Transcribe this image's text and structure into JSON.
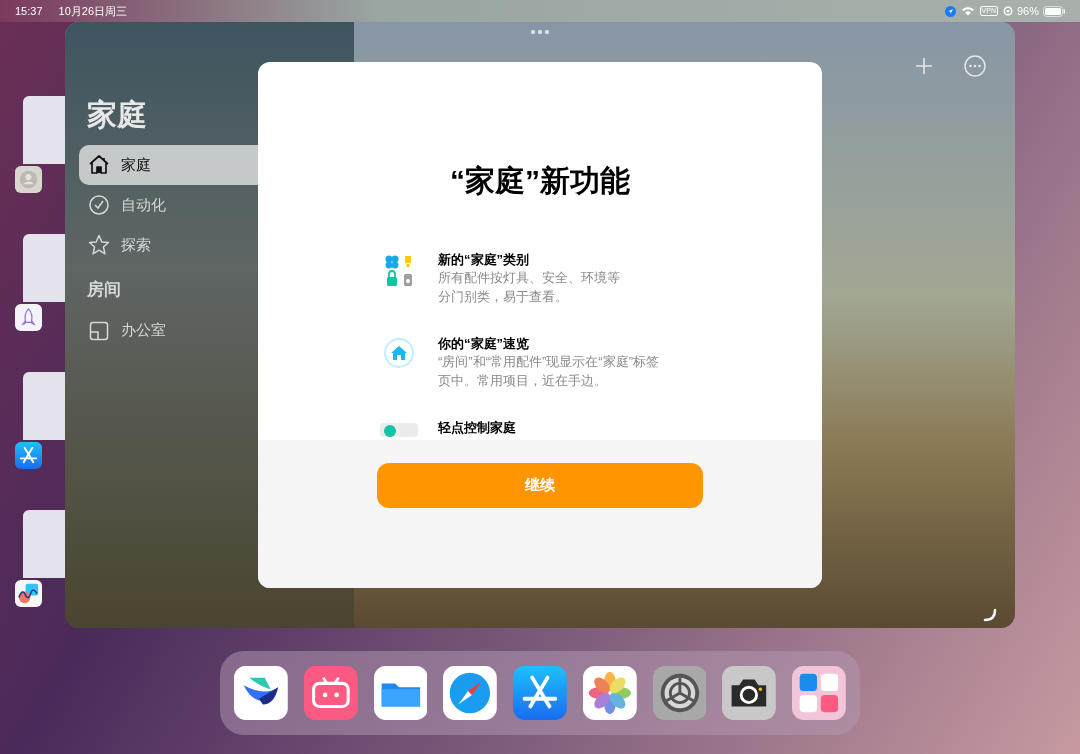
{
  "status_bar": {
    "time": "15:37",
    "date": "10月26日周三",
    "vpn": "VPN",
    "battery": "96%"
  },
  "sidebar": {
    "title": "家庭",
    "items": [
      {
        "kind": "home",
        "label": "家庭",
        "selected": true
      },
      {
        "kind": "automation",
        "label": "自动化",
        "selected": false
      },
      {
        "kind": "explore",
        "label": "探索",
        "selected": false
      }
    ],
    "sections": [
      {
        "title": "房间",
        "items": [
          {
            "kind": "room",
            "label": "办公室",
            "selected": false
          }
        ]
      }
    ]
  },
  "modal": {
    "title": "“家庭”新功能",
    "features": [
      {
        "kind": "categories",
        "title": "新的“家庭”类别",
        "description": [
          "所有配件按灯具、安全、环境等",
          "分门别类，易于查看。"
        ]
      },
      {
        "kind": "overview",
        "title": "你的“家庭”速览",
        "description": [
          "“房间”和“常用配件”现显示在“家庭”标签",
          "页中。常用项目，近在手边。"
        ]
      },
      {
        "kind": "control",
        "title": "轻点控制家庭"
      }
    ],
    "button": "继续"
  },
  "recent_apps": [
    {
      "kind": "contacts"
    },
    {
      "kind": "rocket"
    },
    {
      "kind": "appstore"
    },
    {
      "kind": "freeform"
    }
  ],
  "dock": [
    {
      "kind": "bird"
    },
    {
      "kind": "bilibili"
    },
    {
      "kind": "files"
    },
    {
      "kind": "safari"
    },
    {
      "kind": "appstore"
    },
    {
      "kind": "photos"
    },
    {
      "kind": "settings"
    },
    {
      "kind": "camera"
    },
    {
      "kind": "folder"
    }
  ]
}
